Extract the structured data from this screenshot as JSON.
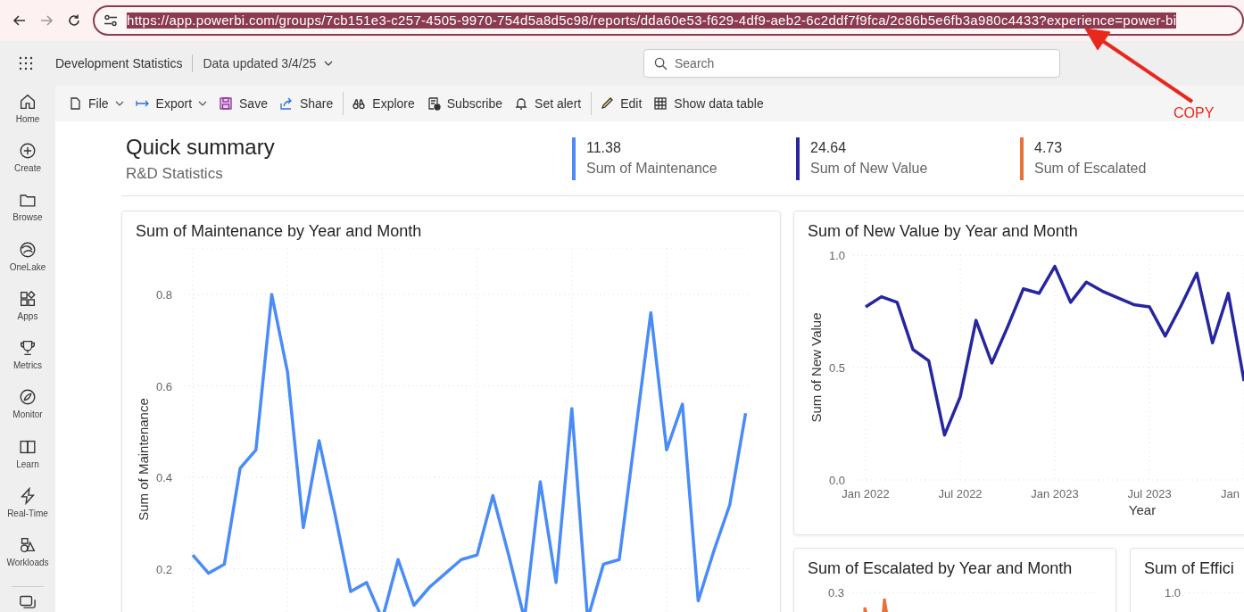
{
  "browser": {
    "nav_buttons": [
      {
        "kind": "back",
        "disabled": false
      },
      {
        "kind": "forward",
        "disabled": true
      },
      {
        "kind": "reload",
        "disabled": false
      }
    ],
    "address_bar": {
      "url": "https://app.powerbi.com/groups/7cb151e3-c257-4505-9970-754d5a8d5c98/reports/dda60e53-f629-4df9-aeb2-6c2ddf7f9fca/2c86b5e6fb3a980c4433?experience=power-bi",
      "selected": true
    }
  },
  "annotation": {
    "text": "COPY"
  },
  "app_header": {
    "report_name": "Development Statistics",
    "data_updated": "Data updated 3/4/25",
    "search": {
      "placeholder": "Search"
    }
  },
  "toolbar": [
    {
      "label": "File",
      "menu": true,
      "separator_before": false
    },
    {
      "label": "Export",
      "menu": true,
      "separator_before": false
    },
    {
      "label": "Save",
      "menu": false,
      "separator_before": false
    },
    {
      "label": "Share",
      "menu": false,
      "separator_before": false
    },
    {
      "label": "Explore",
      "menu": false,
      "separator_before": true
    },
    {
      "label": "Subscribe",
      "menu": false,
      "separator_before": false
    },
    {
      "label": "Set alert",
      "menu": false,
      "separator_before": false
    },
    {
      "label": "Edit",
      "menu": false,
      "separator_before": true
    },
    {
      "label": "Show data table",
      "menu": false,
      "separator_before": false
    }
  ],
  "sidebar": {
    "items": [
      {
        "label": "Home"
      },
      {
        "label": "Create"
      },
      {
        "label": "Browse"
      },
      {
        "label": "OneLake"
      },
      {
        "label": "Apps"
      },
      {
        "label": "Metrics"
      },
      {
        "label": "Monitor"
      },
      {
        "label": "Learn"
      },
      {
        "label": "Real-Time"
      },
      {
        "label": "Workloads"
      }
    ]
  },
  "summary": {
    "title": "Quick summary",
    "subtitle": "R&D Statistics",
    "kpis": [
      {
        "value": "11.38",
        "label": "Sum of Maintenance",
        "color": "#4a8cf7"
      },
      {
        "value": "24.64",
        "label": "Sum of New Value",
        "color": "#2626a0"
      },
      {
        "value": "4.73",
        "label": "Sum of Escalated",
        "color": "#e8703a"
      }
    ]
  },
  "charts": [
    {
      "title": "Sum of Maintenance by Year and Month",
      "chart_data": {
        "type": "line",
        "ylabel": "Sum of Maintenance",
        "grid": true,
        "ylim": [
          0,
          0.9
        ],
        "yticks": [
          {
            "value": 0.2,
            "label": "0.2"
          },
          {
            "value": 0.4,
            "label": "0.4"
          },
          {
            "value": 0.6,
            "label": "0.6"
          },
          {
            "value": 0.8,
            "label": "0.8"
          }
        ],
        "series": [
          {
            "color": "#4a8cf7",
            "values": [
              0.23,
              0.19,
              0.21,
              0.42,
              0.46,
              0.8,
              0.63,
              0.29,
              0.48,
              0.32,
              0.15,
              0.17,
              0.09,
              0.22,
              0.12,
              0.16,
              0.19,
              0.22,
              0.23,
              0.36,
              0.23,
              0.09,
              0.39,
              0.17,
              0.55,
              0.09,
              0.21,
              0.22,
              0.49,
              0.76,
              0.46,
              0.56,
              0.13,
              0.24,
              0.34,
              0.54
            ]
          }
        ]
      }
    },
    {
      "title": "Sum of New Value by Year and Month",
      "edge_tick_label": "Jan",
      "chart_data": {
        "type": "line",
        "xlabel": "Year",
        "ylabel": "Sum of New Value",
        "grid": true,
        "ylim": [
          0,
          1
        ],
        "categories": [
          "Jan 2022",
          null,
          null,
          null,
          null,
          null,
          "Jul 2022",
          null,
          null,
          null,
          null,
          null,
          "Jan 2023",
          null,
          null,
          null,
          null,
          null,
          "Jul 2023",
          null,
          null,
          null,
          null,
          null,
          null
        ],
        "yticks": [
          {
            "value": 0,
            "label": "0.0"
          },
          {
            "value": 0.5,
            "label": "0.5"
          },
          {
            "value": 1,
            "label": "1.0"
          }
        ],
        "series": [
          {
            "color": "#2626a0",
            "values": [
              0.77,
              0.815,
              0.79,
              0.58,
              0.53,
              0.2,
              0.37,
              0.71,
              0.52,
              0.68,
              0.85,
              0.83,
              0.95,
              0.79,
              0.88,
              0.84,
              0.81,
              0.78,
              0.77,
              0.64,
              0.775,
              0.92,
              0.61,
              0.83,
              0.44
            ]
          }
        ]
      }
    }
  ],
  "small_charts": [
    {
      "title": "Sum of Escalated by Year and Month",
      "y_tick_label": "0.3"
    },
    {
      "title": "Sum of Effici",
      "y_tick_label": "1.0"
    }
  ]
}
